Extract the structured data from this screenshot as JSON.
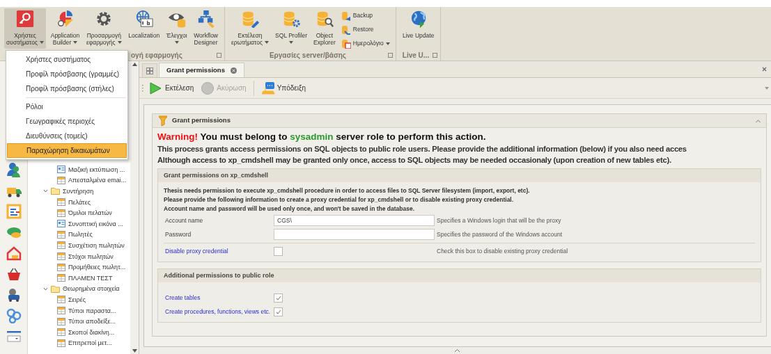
{
  "ribbon": {
    "groups": [
      {
        "label": "ογή εφαρμογής",
        "buttons": [
          {
            "kind": "large",
            "label": "Χρήστες\nσυστήματος",
            "dropdown": true,
            "pressed": true
          },
          {
            "kind": "large",
            "label": "Application\nBuilder",
            "dropdown": true,
            "pressed": false
          },
          {
            "kind": "large",
            "label": "Προσαρμογή\nεφαρμογής",
            "dropdown": true,
            "pressed": false
          },
          {
            "kind": "large",
            "label": "Localization",
            "dropdown": false,
            "pressed": false
          },
          {
            "kind": "large",
            "label": "Έλεγχοι",
            "dropdown": true,
            "pressed": false
          },
          {
            "kind": "large",
            "label": "Workflow\nDesigner",
            "dropdown": false,
            "pressed": false
          }
        ]
      },
      {
        "label": "Εργασίες server/βάσης",
        "buttons": [
          {
            "kind": "large",
            "label": "Εκτέλεση\nερωτήματος",
            "dropdown": true,
            "pressed": false
          },
          {
            "kind": "large",
            "label": "SQL Profiler",
            "dropdown": true,
            "pressed": false
          },
          {
            "kind": "large",
            "label": "Object\nExplorer",
            "dropdown": false,
            "pressed": false
          },
          {
            "kind": "small",
            "label": "Backup",
            "dropdown": false,
            "pressed": false
          },
          {
            "kind": "small",
            "label": "Restore",
            "dropdown": false,
            "pressed": false
          },
          {
            "kind": "small",
            "label": "Ημερολόγιο",
            "dropdown": true,
            "pressed": false
          }
        ]
      },
      {
        "label": "Live U...",
        "buttons": [
          {
            "kind": "large",
            "label": "Live Update",
            "dropdown": false,
            "pressed": false
          }
        ]
      }
    ]
  },
  "menu": {
    "items": [
      {
        "kind": "item",
        "label": "Χρήστες συστήματος",
        "selected": false
      },
      {
        "kind": "item",
        "label": "Προφίλ πρόσβασης (γραμμές)",
        "selected": false
      },
      {
        "kind": "item",
        "label": "Προφίλ πρόσβασης (στήλες)",
        "selected": false
      },
      {
        "kind": "separator"
      },
      {
        "kind": "item",
        "label": "Ρόλοι",
        "selected": false
      },
      {
        "kind": "item",
        "label": "Γεωγραφικές περιοχές",
        "selected": false
      },
      {
        "kind": "item",
        "label": "Διευθύνσεις (τομείς)",
        "selected": false
      },
      {
        "kind": "item",
        "label": "Παραχώρηση δικαιωμάτων",
        "selected": true
      }
    ]
  },
  "tree": [
    {
      "kind": "report",
      "label": "Μαζική εκτύπωση ..."
    },
    {
      "kind": "table",
      "label": "Απεσταλμένα emai..."
    },
    {
      "kind": "folder",
      "label": "Συντήρηση",
      "expanded": true,
      "children": [
        {
          "kind": "table",
          "label": "Πελάτες"
        },
        {
          "kind": "table",
          "label": "Όμιλοι πελατών"
        },
        {
          "kind": "report",
          "label": "Συνοπτική εικόνα ..."
        },
        {
          "kind": "table",
          "label": "Πωλητές"
        },
        {
          "kind": "table",
          "label": "Συσχέτιση πωλητών"
        },
        {
          "kind": "table",
          "label": "Στόχοι πωλητών"
        },
        {
          "kind": "table",
          "label": "Προμήθειες πωλητ..."
        },
        {
          "kind": "table",
          "label": "ΠΛΑΜΕΝ ΤΕΣΤ"
        }
      ]
    },
    {
      "kind": "folder",
      "label": "Θεωρημένα στοιχεία",
      "expanded": true,
      "children": [
        {
          "kind": "table",
          "label": "Σειρές"
        },
        {
          "kind": "table",
          "label": "Τύποι παραστα..."
        },
        {
          "kind": "table",
          "label": "Τύποι αποδείξε..."
        },
        {
          "kind": "table",
          "label": "Σκοποί διακίνη..."
        },
        {
          "kind": "table",
          "label": "Επιτρεποί μετ..."
        }
      ]
    }
  ],
  "tabs": [
    {
      "label": "Grant permissions",
      "selected": true
    }
  ],
  "toolbar": [
    {
      "kind": "button",
      "label": "Εκτέλεση",
      "disabled": false
    },
    {
      "kind": "button",
      "label": "Ακύρωση",
      "disabled": true
    },
    {
      "kind": "separator"
    },
    {
      "kind": "button",
      "label": "Υπόδειξη",
      "disabled": false
    }
  ],
  "panel": {
    "title": "Grant permissions",
    "warning": {
      "prefix": "Warning!",
      "before": "You must belong to",
      "role": "sysadmin",
      "after": "server role to perform this action."
    },
    "description": [
      "This process grants access permissions on SQL objects to public role users. Please provide the additional information (below) if you also need acces",
      "Although access to xp_cmdshell may be granted only once, access to SQL objects may be needed occasionaly (upon creation of new tables etc)."
    ],
    "sections": [
      {
        "title": "Grant permissions on xp_cmdshell",
        "notes": [
          "Thesis needs permission to execute xp_cmdshell procedure in order to access files to SQL Server filesystem (import, export, etc).",
          "Please provide the following information to create a proxy credential for xp_cmdshell or to disable existing proxy credential.",
          "Account name and password will be used only once, and won't be saved in the database."
        ],
        "fields": [
          {
            "kind": "text",
            "label": "Account name",
            "value": "CGS\\",
            "hint": "Specifies a Windows login that will be the proxy"
          },
          {
            "kind": "password",
            "label": "Password",
            "hint": "Specifies the password of the Windows account"
          },
          {
            "kind": "checkbox",
            "label": "Disable proxy credential",
            "checked": false,
            "hint": "Check this box to disable existing proxy credential"
          }
        ]
      },
      {
        "title": "Additional permissions to public role",
        "fields": [
          {
            "kind": "checkbox",
            "label": "Create tables",
            "checked": true
          },
          {
            "kind": "checkbox",
            "label": "Create procedures, functions, views etc.",
            "checked": true
          }
        ]
      }
    ]
  }
}
